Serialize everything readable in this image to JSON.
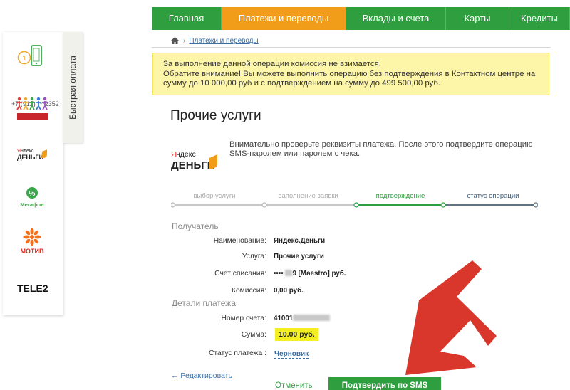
{
  "nav": {
    "items": [
      {
        "label": "Главная",
        "width": 98
      },
      {
        "label": "Платежи и переводы",
        "width": 175,
        "active": true
      },
      {
        "label": "Вклады и счета",
        "width": 140
      },
      {
        "label": "Карты",
        "width": 89
      },
      {
        "label": "Кредиты",
        "width": 85
      }
    ]
  },
  "breadcrumb": {
    "link": "Платежи и переводы"
  },
  "notice": {
    "lines": [
      "За выполнение данной операции комиссия не взимается.",
      "Обратите внимание! Вы можете выполнить операцию без подтверждения в Контактном центре на",
      "сумму до 10 000,00 руб и с подтверждением на сумму до 499 500,00 руб."
    ]
  },
  "quick_pay": {
    "tab_label": "Быстрая оплата",
    "phone": "+7 (912) ***2352",
    "operators": [
      "Мегафон",
      "МОТИВ",
      "TELE2"
    ]
  },
  "page": {
    "title": "Прочие услуги",
    "description": "Внимательно проверьте реквизиты платежа. После этого подтвердите операцию SMS-паролем или паролем с чека."
  },
  "steps": [
    {
      "label": "выбор услуги",
      "state": "done"
    },
    {
      "label": "заполнение заявки",
      "state": "done"
    },
    {
      "label": "подтверждение",
      "state": "current"
    },
    {
      "label": "статус операции",
      "state": "next"
    }
  ],
  "recipient": {
    "section_label": "Получатель",
    "name_label": "Наименование:",
    "name_value": "Яндекс.Деньги",
    "service_label": "Услуга:",
    "service_value": "Прочие услуги",
    "account_label": "Счет списания:",
    "account_prefix": "••••",
    "account_suffix": "9  [Maestro]  руб.",
    "fee_label": "Комиссия:",
    "fee_value": "0,00 руб."
  },
  "details": {
    "section_label": "Детали платежа",
    "number_label": "Номер счета:",
    "number_value": "41001",
    "sum_label": "Сумма:",
    "sum_value": "10.00 руб.",
    "status_label": "Статус платежа :",
    "status_value": "Черновик"
  },
  "actions": {
    "edit": "Редактировать",
    "edit_arrow": "←",
    "cancel": "Отменить",
    "confirm": "Подтвердить по SMS"
  },
  "colors": {
    "green": "#2e9e3f",
    "orange": "#f29d1a",
    "notice_bg": "#fdf5a8",
    "arrow": "#d9362c"
  }
}
